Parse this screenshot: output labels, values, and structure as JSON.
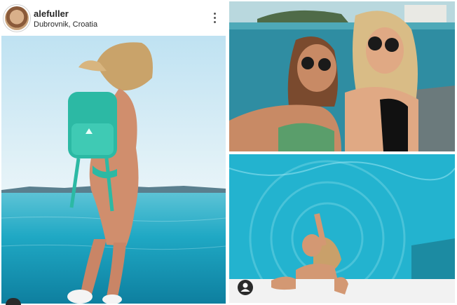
{
  "post": {
    "username": "alefuller",
    "location": "Dubrovnik, Croatia"
  },
  "icons": {
    "more": "more-options-icon",
    "user_tag": "user-tag-icon"
  },
  "colors": {
    "sea": "#1fa8c4",
    "pool": "#23b3cf",
    "backpack": "#2cb9a4"
  }
}
